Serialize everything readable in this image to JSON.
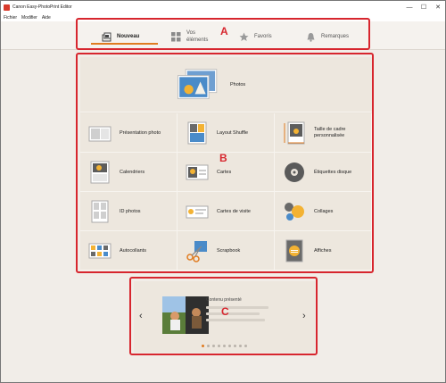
{
  "window": {
    "title": "Canon Easy-PhotoPrint Editor",
    "minimize": "—",
    "maximize": "☐",
    "close": "✕"
  },
  "menu": [
    "Fichier",
    "Modifier",
    "Aide"
  ],
  "tabs": [
    {
      "label": "Nouveau",
      "icon": "new-project-icon"
    },
    {
      "label": "Vos éléments",
      "icon": "grid-icon"
    },
    {
      "label": "Favoris",
      "icon": "star-icon"
    },
    {
      "label": "Remarques",
      "icon": "bell-icon"
    }
  ],
  "markers": {
    "a": "A",
    "b": "B",
    "c": "C"
  },
  "main": {
    "photos_label": "Photos",
    "items": [
      "Présentation photo",
      "Layout Shuffle",
      "Taille de cadre personnalisée",
      "Calendriers",
      "Cartes",
      "Étiquettes disque",
      "ID photos",
      "Cartes de visite",
      "Collages",
      "Autocollants",
      "Scrapbook",
      "Affiches"
    ]
  },
  "featured": {
    "title": "Contenu présenté",
    "prev": "‹",
    "next": "›",
    "slide_count": 9,
    "active_slide": 1
  },
  "colors": {
    "accent": "#e07b20",
    "annotation": "#d7262e"
  }
}
